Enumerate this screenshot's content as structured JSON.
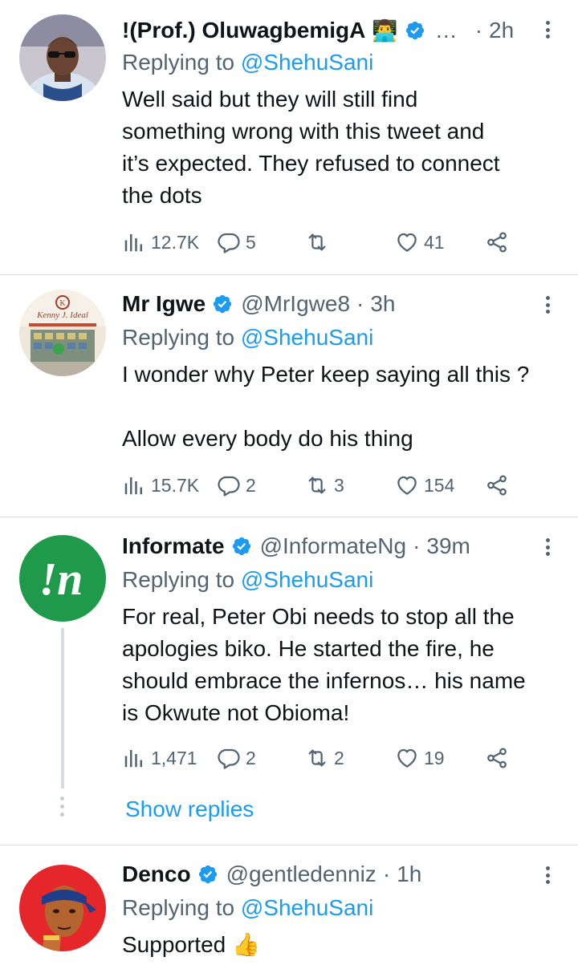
{
  "tweets": [
    {
      "name": "!(Prof.) OluwagbemigA",
      "emoji": "👨‍💻",
      "handle": "…",
      "time": "2h",
      "replying_label": "Replying to",
      "replying_to": "@ShehuSani",
      "text": "Well said but they will still find\nsomething wrong with this tweet and\nit’s expected. They refused to connect\nthe dots",
      "views": "12.7K",
      "replies": "5",
      "retweets": "",
      "likes": "41"
    },
    {
      "name": "Mr Igwe",
      "handle": "@MrIgwe8",
      "time": "3h",
      "replying_label": "Replying to",
      "replying_to": "@ShehuSani",
      "text": "I wonder why Peter keep saying all this ?\n\nAllow every body do his thing",
      "avatar_sign": "Kenny J. Ideal",
      "views": "15.7K",
      "replies": "2",
      "retweets": "3",
      "likes": "154"
    },
    {
      "name": "Informate",
      "handle": "@InformateNg",
      "time": "39m",
      "replying_label": "Replying to",
      "replying_to": "@ShehuSani",
      "text": "For real, Peter Obi needs to stop all the\napologies biko. He started the fire, he\nshould embrace the infernos… his name\nis Okwute not Obioma!",
      "avatar_logo": "!n",
      "views": "1,471",
      "replies": "2",
      "retweets": "2",
      "likes": "19",
      "show_replies": "Show replies"
    },
    {
      "name": "Denco",
      "handle": "@gentledenniz",
      "time": "1h",
      "replying_label": "Replying to",
      "replying_to": "@ShehuSani",
      "text": "Supported 👍"
    }
  ],
  "separator": "·",
  "colors": {
    "accent": "#1d9bf0",
    "secondary_text": "#536471",
    "divider": "#d7dce0",
    "informate_green": "#1f9a4a",
    "denco_red": "#e5262b"
  },
  "icons": [
    "verified-badge-icon",
    "more-options-icon",
    "views-icon",
    "reply-icon",
    "retweet-icon",
    "like-icon",
    "share-icon"
  ]
}
